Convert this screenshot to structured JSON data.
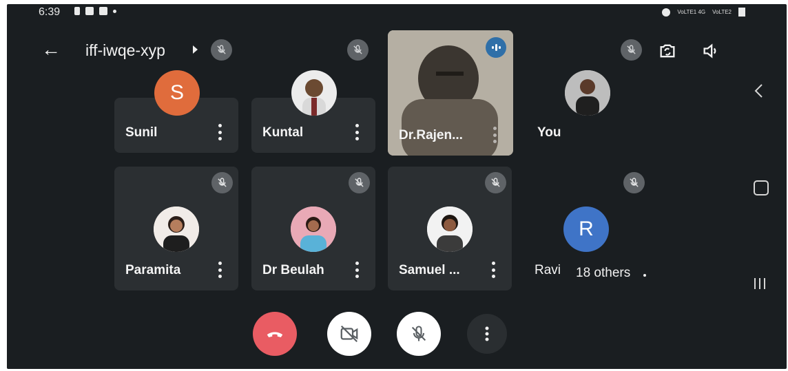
{
  "status_bar": {
    "time": "6:39",
    "network_left": "VoLTE1 4G",
    "network_right": "VoLTE2"
  },
  "meeting": {
    "code": "iff-iwqe-xyp",
    "more_participants_label": "18 others"
  },
  "participants": [
    {
      "name": "Sunil",
      "initial": "S",
      "avatar_color": "#e06c3c",
      "muted": false
    },
    {
      "name": "Kuntal",
      "initial": "",
      "avatar_color": "#e8e8e8",
      "muted": true
    },
    {
      "name": "Dr.Rajen...",
      "initial": "",
      "avatar_color": "#b8b2a6",
      "muted": false,
      "speaking": true
    },
    {
      "name": "You",
      "initial": "",
      "avatar_color": "#cfcfcf",
      "muted": true
    },
    {
      "name": "Paramita",
      "initial": "",
      "avatar_color": "#f0e6e0",
      "muted": true
    },
    {
      "name": "Dr Beulah",
      "initial": "",
      "avatar_color": "#e9b8c4",
      "muted": true
    },
    {
      "name": "Samuel ...",
      "initial": "",
      "avatar_color": "#eeeeee",
      "muted": true
    },
    {
      "name": "Ravi",
      "initial": "R",
      "avatar_color": "#3f74c7",
      "muted": true
    }
  ],
  "colors": {
    "background": "#1a1e21",
    "tile": "#2b2f32",
    "end_call": "#e95c63",
    "mute_badge": "#5f6367",
    "speaker_badge": "#2f6fa8"
  },
  "icons": {
    "back": "arrow-left-icon",
    "switch_camera": "camera-switch-icon",
    "speaker": "speaker-icon",
    "end_call": "phone-hangup-icon",
    "camera_off": "video-off-icon",
    "mic_off": "mic-off-icon",
    "more": "more-vertical-icon"
  }
}
